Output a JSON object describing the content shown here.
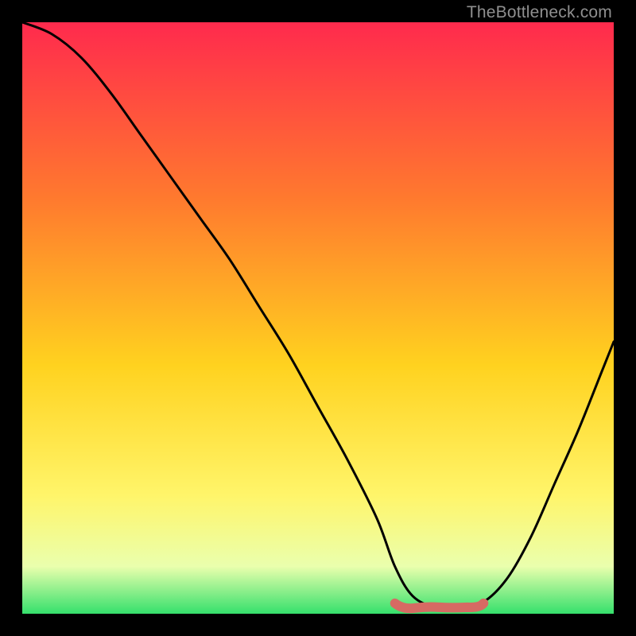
{
  "watermark": "TheBottleneck.com",
  "colors": {
    "bg": "#000000",
    "gradient_top": "#ff2a4d",
    "gradient_mid1": "#ff7a2e",
    "gradient_mid2": "#ffd21f",
    "gradient_mid3": "#fff56a",
    "gradient_low": "#eaffad",
    "gradient_bottom": "#35e06c",
    "curve": "#000000",
    "marker": "#d66a63"
  },
  "chart_data": {
    "type": "line",
    "title": "",
    "xlabel": "",
    "ylabel": "",
    "xlim": [
      0,
      100
    ],
    "ylim": [
      0,
      100
    ],
    "grid": false,
    "legend": false,
    "series": [
      {
        "name": "bottleneck-curve",
        "x": [
          0,
          5,
          10,
          15,
          20,
          25,
          30,
          35,
          40,
          45,
          50,
          55,
          60,
          63,
          66,
          70,
          74,
          78,
          82,
          86,
          90,
          94,
          98,
          100
        ],
        "values": [
          100,
          98,
          94,
          88,
          81,
          74,
          67,
          60,
          52,
          44,
          35,
          26,
          16,
          8,
          3,
          1,
          1,
          2,
          6,
          13,
          22,
          31,
          41,
          46
        ]
      }
    ],
    "optimal_band": {
      "name": "optimal-range-marker",
      "x_start": 63,
      "x_end": 78,
      "y": 1.5
    }
  }
}
